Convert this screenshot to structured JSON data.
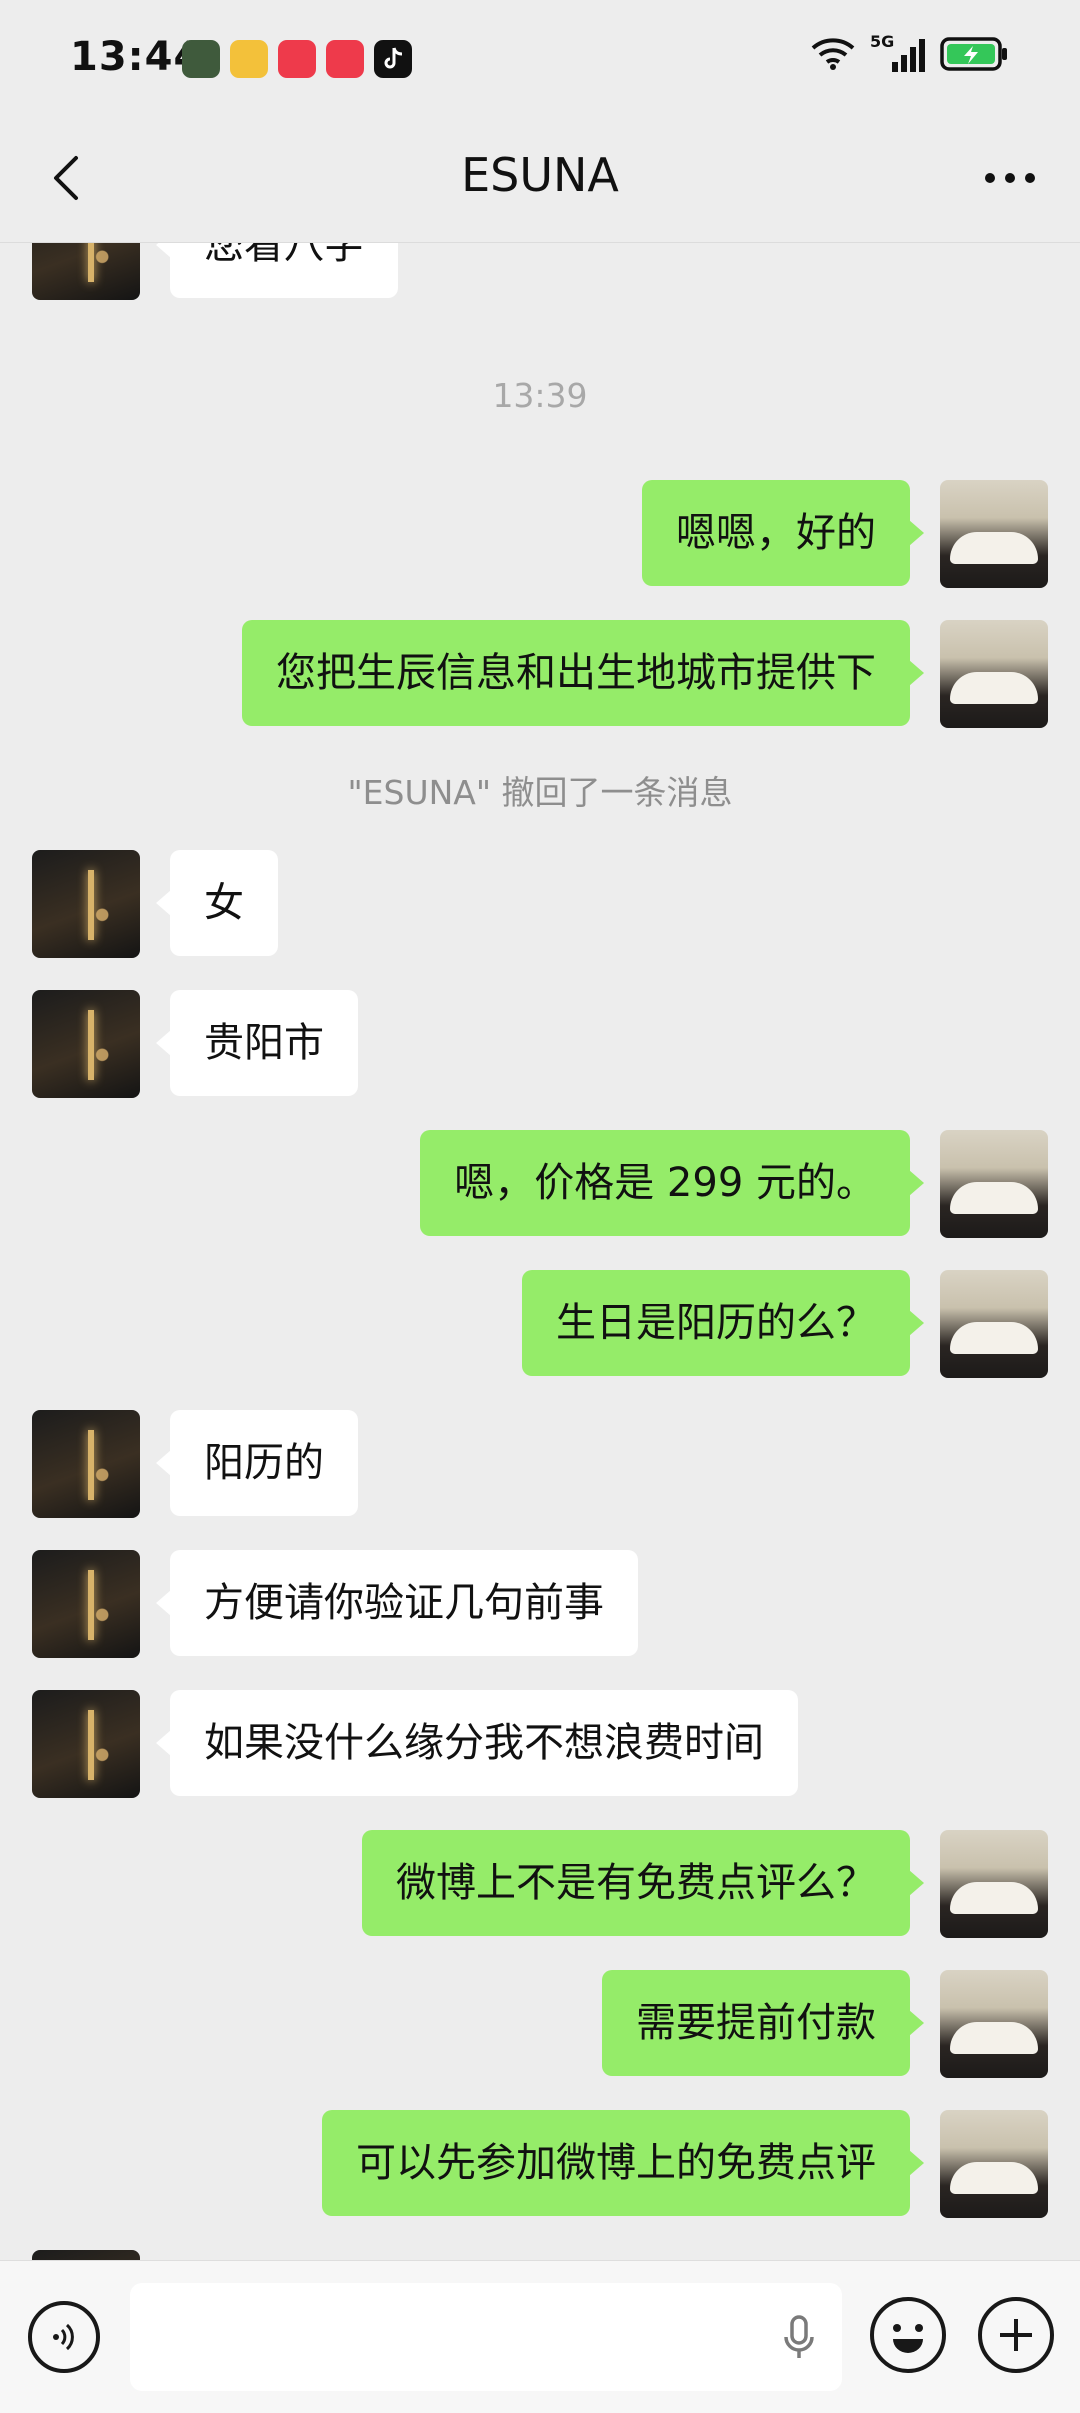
{
  "status_bar": {
    "time": "13:44",
    "network": "5G",
    "app_icons": [
      "train-icon",
      "weibo-icon",
      "xiaohongshu-icon",
      "xiaohongshu-icon",
      "tiktok-icon"
    ]
  },
  "header": {
    "title": "ESUNA"
  },
  "chat": {
    "partial_top_text": "您看八字",
    "timestamp": "13:39",
    "recall_notice": "\"ESUNA\" 撤回了一条消息",
    "messages": [
      {
        "side": "right",
        "text": "嗯嗯，好的"
      },
      {
        "side": "right",
        "text": "您把生辰信息和出生地城市提供下"
      },
      {
        "side": "left",
        "text": "女"
      },
      {
        "side": "left",
        "text": "贵阳市"
      },
      {
        "side": "right",
        "text": "嗯，价格是 299 元的。"
      },
      {
        "side": "right",
        "text": "生日是阳历的么？"
      },
      {
        "side": "left",
        "text": "阳历的"
      },
      {
        "side": "left",
        "text": "方便请你验证几句前事"
      },
      {
        "side": "left",
        "text": "如果没什么缘分我不想浪费时间"
      },
      {
        "side": "right",
        "text": "微博上不是有免费点评么？"
      },
      {
        "side": "right",
        "text": "需要提前付款"
      },
      {
        "side": "right",
        "text": "可以先参加微博上的免费点评"
      }
    ]
  },
  "colors": {
    "sent_bubble": "#95ec69",
    "received_bubble": "#ffffff",
    "background": "#ededed"
  }
}
